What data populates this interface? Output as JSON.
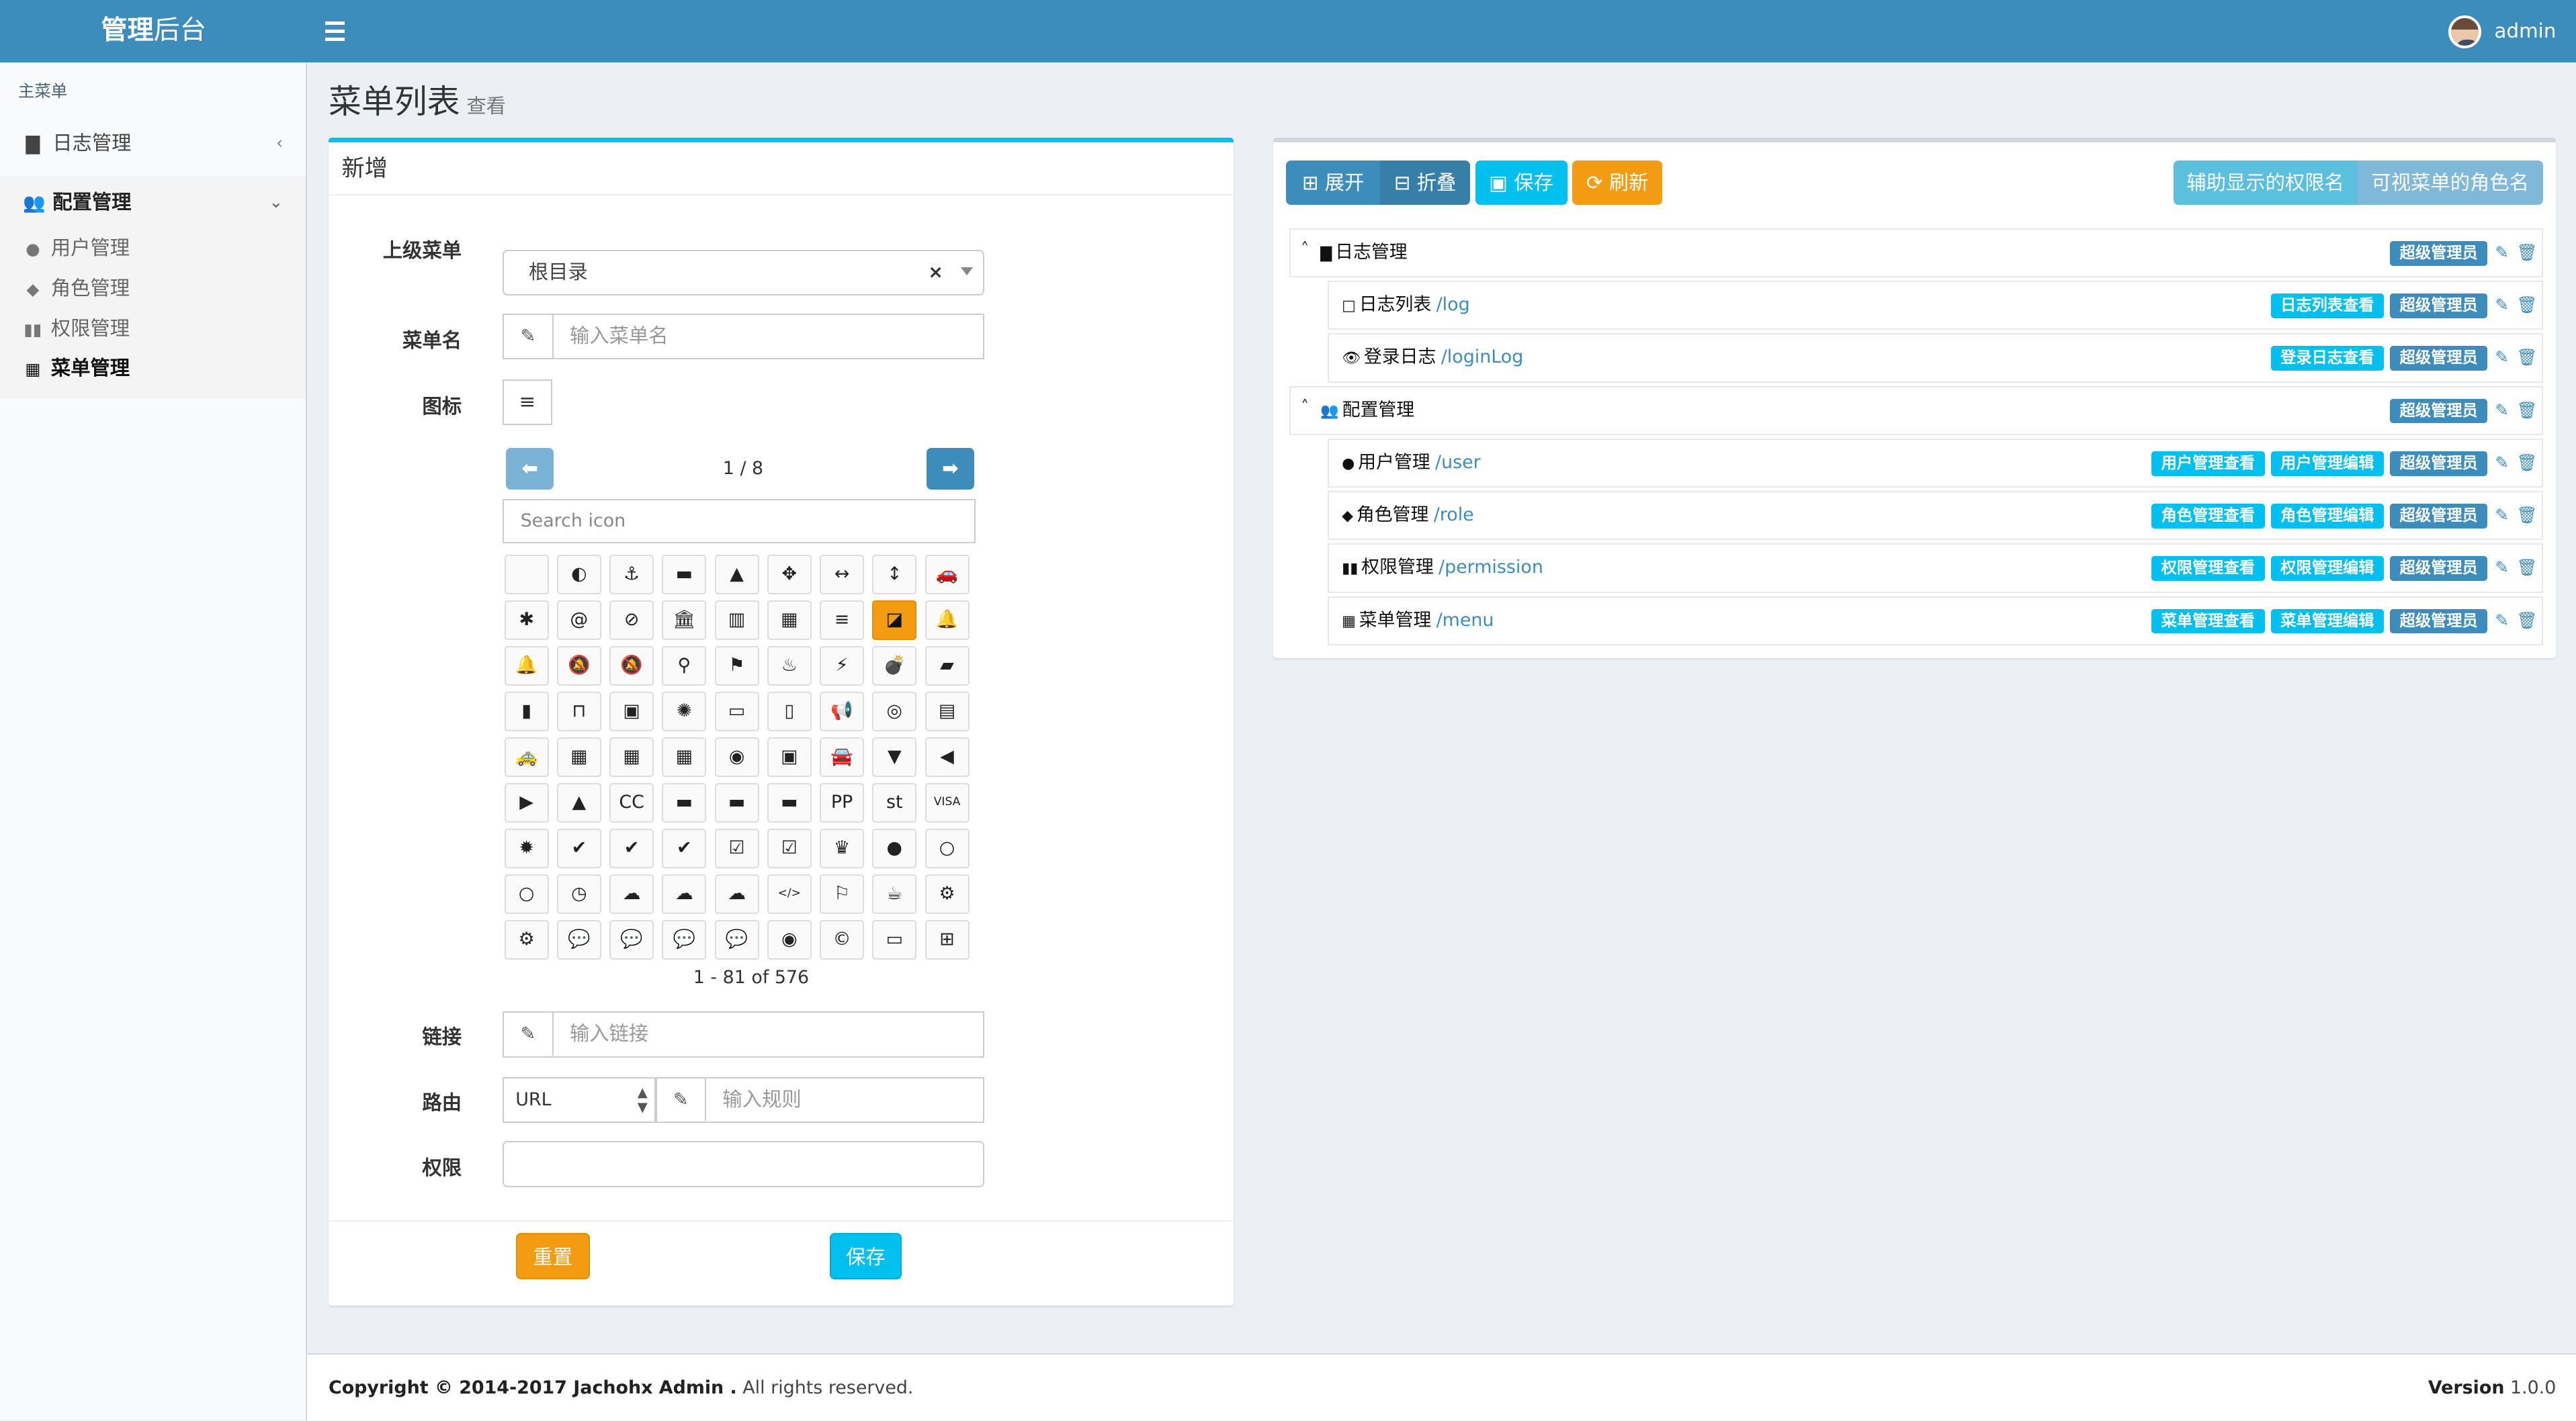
{
  "header": {
    "logo_bold": "管理",
    "logo_light": "后台",
    "username": "admin"
  },
  "sidebar": {
    "header": "主菜单",
    "items": [
      {
        "label": "日志管理",
        "icon": "file-icon",
        "glyph": "▇",
        "chevron": "‹"
      },
      {
        "label": "配置管理",
        "icon": "users-icon",
        "glyph": "👥",
        "chevron": "⌄"
      }
    ],
    "sub_items": [
      {
        "label": "用户管理",
        "glyph": "●"
      },
      {
        "label": "角色管理",
        "glyph": "◆"
      },
      {
        "label": "权限管理",
        "glyph": "▮▮"
      },
      {
        "label": "菜单管理",
        "glyph": "▦"
      }
    ]
  },
  "page": {
    "title": "菜单列表",
    "subtitle": "查看"
  },
  "form": {
    "box_title": "新增",
    "parent_label": "上级菜单",
    "parent_value": "根目录",
    "parent_clear": "×",
    "name_label": "菜单名",
    "name_placeholder": "输入菜单名",
    "icon_label": "图标",
    "page_indicator": "1 / 8",
    "search_placeholder": "Search icon",
    "range_text": "1 - 81 of 576",
    "link_label": "链接",
    "link_placeholder": "输入链接",
    "route_label": "路由",
    "route_type": "URL",
    "route_placeholder": "输入规则",
    "perm_label": "权限",
    "reset_button": "重置",
    "save_button": "保存"
  },
  "icon_grid": [
    "",
    "◐",
    "⚓",
    "▬",
    "▲",
    "✥",
    "↔",
    "↕",
    "🚗",
    "✱",
    "@",
    "⊘",
    "🏛",
    "▥",
    "▦",
    "≡",
    "◪",
    "🔔",
    "🔔",
    "🔕",
    "🔕",
    "⚲",
    "⚑",
    "♨",
    "⚡",
    "💣",
    "▰",
    "▮",
    "⊓",
    "▣",
    "✺",
    "▭",
    "▯",
    "📢",
    "◎",
    "▤",
    "🚕",
    "▦",
    "▦",
    "▦",
    "◉",
    "▣",
    "🚘",
    "▼",
    "◀",
    "▶",
    "▲",
    "CC",
    "▬",
    "▬",
    "▬",
    "PP",
    "st",
    "VISA",
    "✹",
    "✔",
    "✔",
    "✔",
    "☑",
    "☑",
    "♛",
    "●",
    "○",
    "○",
    "◷",
    "☁",
    "☁",
    "☁",
    "</>",
    "⚐",
    "☕",
    "⚙",
    "⚙",
    "💬",
    "💬",
    "💬",
    "💬",
    "◉",
    "©",
    "▭",
    "⊞"
  ],
  "icon_grid_selected": 16,
  "toolbar": {
    "expand": "⊞ 展开",
    "collapse": "⊟ 折叠",
    "save": "保存",
    "refresh": "刷新",
    "perm_name": "辅助显示的权限名",
    "role_name": "可视菜单的角色名"
  },
  "tree": [
    {
      "name": "日志管理",
      "path": "",
      "glyph": "▇",
      "toggle": "˄",
      "labels": [
        {
          "text": "超级管理员",
          "kind": "blue"
        }
      ]
    },
    {
      "name": "日志列表",
      "path": "/log",
      "glyph": "□",
      "labels": [
        {
          "text": "日志列表查看",
          "kind": "aqua"
        },
        {
          "text": "超级管理员",
          "kind": "blue"
        }
      ]
    },
    {
      "name": "登录日志",
      "path": "/loginLog",
      "glyph": "👁",
      "labels": [
        {
          "text": "登录日志查看",
          "kind": "aqua"
        },
        {
          "text": "超级管理员",
          "kind": "blue"
        }
      ]
    },
    {
      "name": "配置管理",
      "path": "",
      "glyph": "👥",
      "toggle": "˄",
      "labels": [
        {
          "text": "超级管理员",
          "kind": "blue"
        }
      ]
    },
    {
      "name": "用户管理",
      "path": "/user",
      "glyph": "●",
      "labels": [
        {
          "text": "用户管理查看",
          "kind": "aqua"
        },
        {
          "text": "用户管理编辑",
          "kind": "aqua"
        },
        {
          "text": "超级管理员",
          "kind": "blue"
        }
      ]
    },
    {
      "name": "角色管理",
      "path": "/role",
      "glyph": "◆",
      "labels": [
        {
          "text": "角色管理查看",
          "kind": "aqua"
        },
        {
          "text": "角色管理编辑",
          "kind": "aqua"
        },
        {
          "text": "超级管理员",
          "kind": "blue"
        }
      ]
    },
    {
      "name": "权限管理",
      "path": "/permission",
      "glyph": "▮▮",
      "labels": [
        {
          "text": "权限管理查看",
          "kind": "aqua"
        },
        {
          "text": "权限管理编辑",
          "kind": "aqua"
        },
        {
          "text": "超级管理员",
          "kind": "blue"
        }
      ]
    },
    {
      "name": "菜单管理",
      "path": "/menu",
      "glyph": "▦",
      "labels": [
        {
          "text": "菜单管理查看",
          "kind": "aqua"
        },
        {
          "text": "菜单管理编辑",
          "kind": "aqua"
        },
        {
          "text": "超级管理员",
          "kind": "blue"
        }
      ]
    }
  ],
  "footer": {
    "copyright_bold": "Copyright © 2014-2017 Jachohx Admin .",
    "copyright_rest": " All rights reserved.",
    "version_label": "Version",
    "version_value": " 1.0.0"
  },
  "colors": {
    "primary": "#3c8dbc",
    "aqua": "#00c0ef",
    "warning": "#f39c12"
  }
}
